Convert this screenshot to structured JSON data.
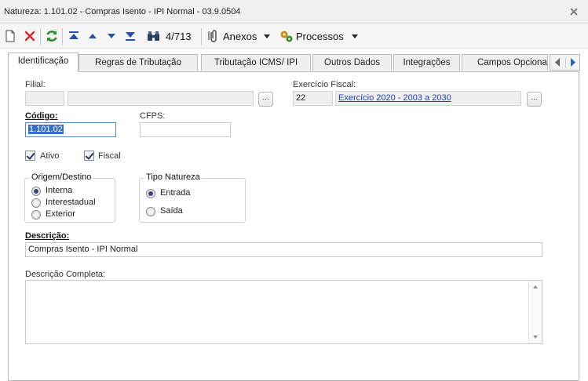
{
  "window": {
    "title": "Natureza: 1.101.02 - Compras Isento - IPI Normal - 03.9.0504"
  },
  "toolbar": {
    "record_counter": "4/713",
    "anexos_label": "Anexos",
    "processos_label": "Processos"
  },
  "tabs": [
    {
      "label": "Identificação"
    },
    {
      "label": "Regras de Tributação"
    },
    {
      "label": "Tributação ICMS/ IPI"
    },
    {
      "label": "Outros Dados"
    },
    {
      "label": "Integrações"
    },
    {
      "label": "Campos Opcionais"
    }
  ],
  "form": {
    "filial_label": "Filial:",
    "filial_code": "",
    "filial_name": "",
    "exercicio_label": "Exercício Fiscal:",
    "exercicio_code": "22",
    "exercicio_link": "Exercício 2020 - 2003 a 2030",
    "codigo_label": "Código:",
    "codigo_value": "1.101.02",
    "cfps_label": "CFPS:",
    "cfps_value": "",
    "ativo_label": "Ativo",
    "ativo_checked": true,
    "fiscal_label": "Fiscal",
    "fiscal_checked": true,
    "origem_title": "Origem/Destino",
    "origem_options": [
      "Interna",
      "Interestadual",
      "Exterior"
    ],
    "origem_selected": "Interna",
    "tipo_title": "Tipo Natureza",
    "tipo_options": [
      "Entrada",
      "Saída"
    ],
    "tipo_selected": "Entrada",
    "descricao_label": "Descrição:",
    "descricao_value": "Compras Isento - IPI Normal",
    "descricao_completa_label": "Descrição Completa:",
    "descricao_completa_value": "",
    "lookup_button": "..."
  },
  "colors": {
    "accent": "#3a6fc9",
    "link": "#1a3eb8",
    "delete": "#d8262b",
    "refresh": "#2e8b2e"
  }
}
